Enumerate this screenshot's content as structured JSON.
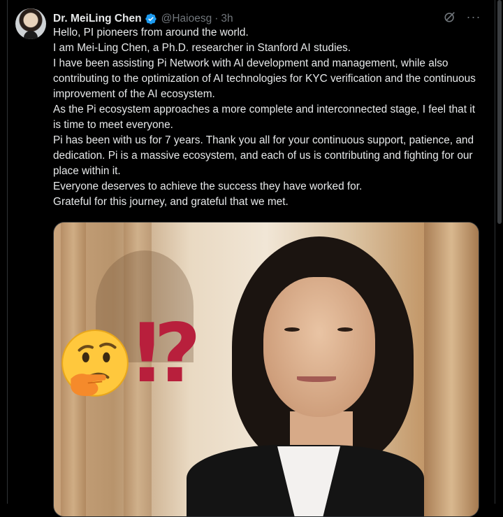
{
  "tweet": {
    "author_name": "Dr. MeiLing Chen",
    "handle": "@Haioesg",
    "separator": "·",
    "time": "3h",
    "verified": true,
    "icons": {
      "verified": "verified-badge-icon",
      "grok": "grok-icon",
      "more": "more-options-icon"
    },
    "more_label": "···",
    "paragraphs": [
      "Hello, PI pioneers from around the world.",
      "I am Mei-Ling Chen, a Ph.D. researcher in Stanford AI studies.",
      "I have been assisting Pi Network with AI development and management, while also contributing to the optimization of AI technologies for KYC verification and the continuous improvement of the AI ecosystem.",
      "As the Pi ecosystem approaches a more complete and interconnected stage, I feel that it is time to meet everyone.",
      "Pi has been with us for 7 years. Thank you all for your continuous support, patience, and dedication. Pi is a massive ecosystem, and each of us is contributing and fighting for our place within it.",
      "Everyone deserves to achieve the success they have worked for.",
      "Grateful for this journey, and grateful that we met."
    ],
    "media": {
      "overlay_text": "⁉",
      "emoji": "thinking-face-icon"
    }
  },
  "colors": {
    "background": "#000000",
    "text": "#e7e9ea",
    "muted": "#71767b",
    "verified_blue": "#1d9bf0",
    "interrobang": "#b81f3c"
  }
}
